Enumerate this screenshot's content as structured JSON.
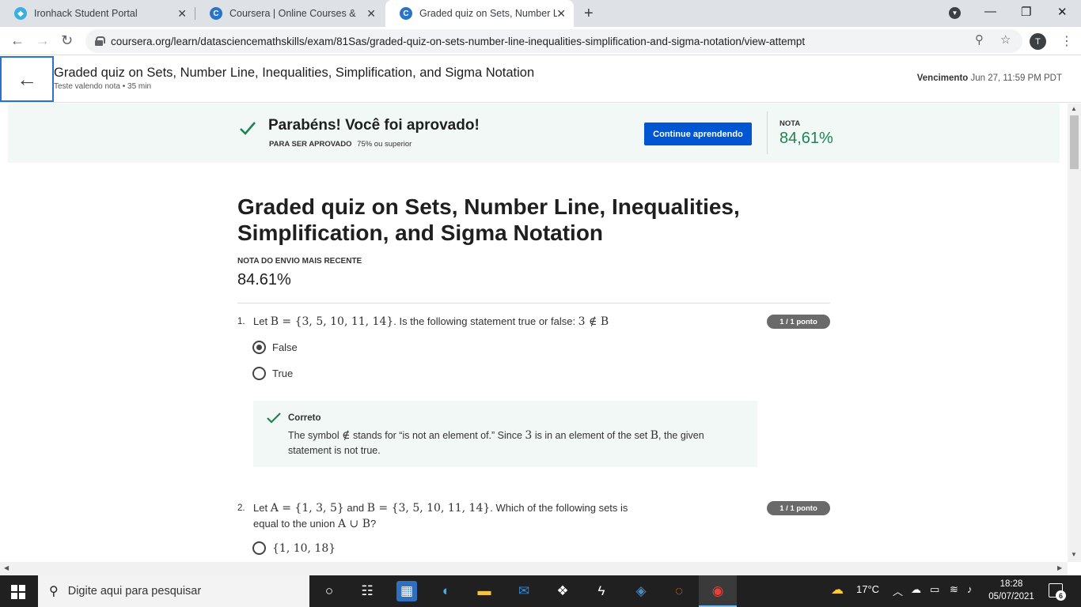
{
  "browser": {
    "tabs": [
      {
        "title": "Ironhack Student Portal",
        "favicon": "ironhack-icon",
        "color": "#3ab0e2"
      },
      {
        "title": "Coursera | Online Courses & Cred",
        "favicon": "coursera-icon",
        "color": "#2a73cc"
      },
      {
        "title": "Graded quiz on Sets, Number Lin",
        "favicon": "coursera-icon",
        "color": "#2a73cc"
      }
    ],
    "url": "coursera.org/learn/datasciencemathskills/exam/81Sas/graded-quiz-on-sets-number-line-inequalities-simplification-and-sigma-notation/view-attempt",
    "profile_initial": "T"
  },
  "header": {
    "title": "Graded quiz on Sets, Number Line, Inequalities, Simplification, and Sigma Notation",
    "subtitle": "Teste valendo nota • 35 min",
    "due_label": "Vencimento",
    "due_value": "Jun 27, 11:59 PM PDT"
  },
  "banner": {
    "title": "Parabéns! Você foi aprovado!",
    "req_label": "PARA SER APROVADO",
    "req_value": "75% ou superior",
    "continue_label": "Continue aprendendo",
    "grade_label": "NOTA",
    "grade_value": "84,61%",
    "accent_color": "#1f8354"
  },
  "quiz": {
    "title": "Graded quiz on Sets, Number Line, Inequalities, Simplification, and Sigma Notation",
    "recent_label": "NOTA DO ENVIO MAIS RECENTE",
    "recent_value": "84.61%",
    "questions": [
      {
        "number": "1.",
        "text_a": "Let ",
        "math_a": "B = {3, 5, 10, 11, 14}",
        "text_b": ". Is the following statement true or false: ",
        "math_b": "3 ∉ B",
        "points": "1 / 1 ponto",
        "options": [
          {
            "label": "False",
            "selected": true
          },
          {
            "label": "True",
            "selected": false
          }
        ],
        "feedback": {
          "title": "Correto",
          "text_a": "The symbol ",
          "math_a": "∉",
          "text_b": " stands for “is not an element of.” Since ",
          "math_b": "3",
          "text_c": " is in an element of the set ",
          "math_c": "B",
          "text_d": ", the given statement is not true."
        }
      },
      {
        "number": "2.",
        "text_a": "Let ",
        "math_a": "A = {1, 3, 5}",
        "text_b": " and ",
        "math_b": "B = {3, 5, 10, 11, 14}",
        "text_c": ". Which of the following sets is equal to the union ",
        "math_c": "A ∪ B",
        "text_d": "?",
        "points": "1 / 1 ponto",
        "options": [
          {
            "label": "{1, 10, 18}",
            "selected": false
          }
        ]
      }
    ]
  },
  "taskbar": {
    "search_placeholder": "Digite aqui para pesquisar",
    "temperature": "17°C",
    "time": "18:28",
    "date": "05/07/2021",
    "notification_count": "6"
  }
}
